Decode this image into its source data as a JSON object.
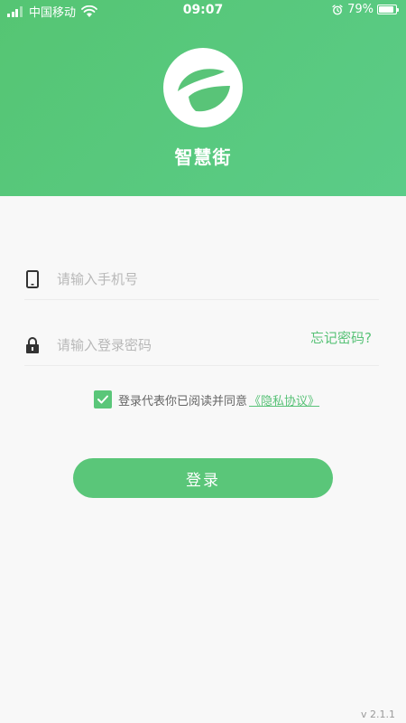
{
  "status_bar": {
    "carrier": "中国移动",
    "time": "09:07",
    "battery": "79%",
    "battery_level": 0.79
  },
  "header": {
    "app_name": "智慧街",
    "logo_icon": "leaf-logo-icon",
    "background_color": "#55c573"
  },
  "form": {
    "phone": {
      "placeholder": "请输入手机号",
      "value": "",
      "icon": "phone-icon"
    },
    "password": {
      "placeholder": "请输入登录密码",
      "value": "",
      "icon": "lock-icon"
    },
    "forgot_label": "忘记密码?",
    "agreement_text": "登录代表你已阅读并同意",
    "policy_link": "《隐私协议》",
    "agreement_checked": true,
    "login_label": "登录"
  },
  "footer": {
    "version": "v 2.1.1"
  },
  "colors": {
    "accent": "#5ac679",
    "page_background": "#f8f8f8"
  }
}
